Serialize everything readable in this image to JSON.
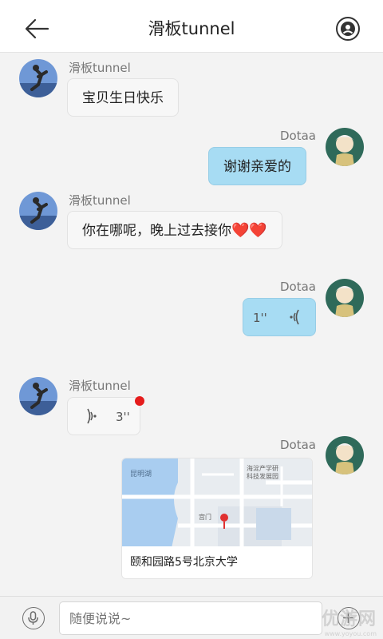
{
  "header": {
    "title": "滑板tunnel"
  },
  "messages": [
    {
      "sender": "滑板tunnel",
      "type": "text",
      "text": "宝贝生日快乐"
    },
    {
      "sender": "Dotaa",
      "type": "text",
      "text": "谢谢亲爱的"
    },
    {
      "sender": "滑板tunnel",
      "type": "text",
      "text": "你在哪呢，晚上过去接你",
      "emoji": "❤️❤️"
    },
    {
      "sender": "Dotaa",
      "type": "voice",
      "duration": "1''"
    },
    {
      "sender": "滑板tunnel",
      "type": "voice",
      "duration": "3''"
    },
    {
      "sender": "Dotaa",
      "type": "location",
      "address": "颐和园路5号北京大学",
      "map_labels": [
        "昆明湖",
        "海淀产学研 科技发展园",
        "宫门"
      ]
    }
  ],
  "input": {
    "placeholder": "随便说说~"
  },
  "watermark": {
    "text": "优游网",
    "url": "www.yoyou.com"
  },
  "colors": {
    "outgoing_bubble": "#a7dcf3",
    "incoming_bubble": "#f7f7f7",
    "unread_dot": "#e51c1c"
  }
}
